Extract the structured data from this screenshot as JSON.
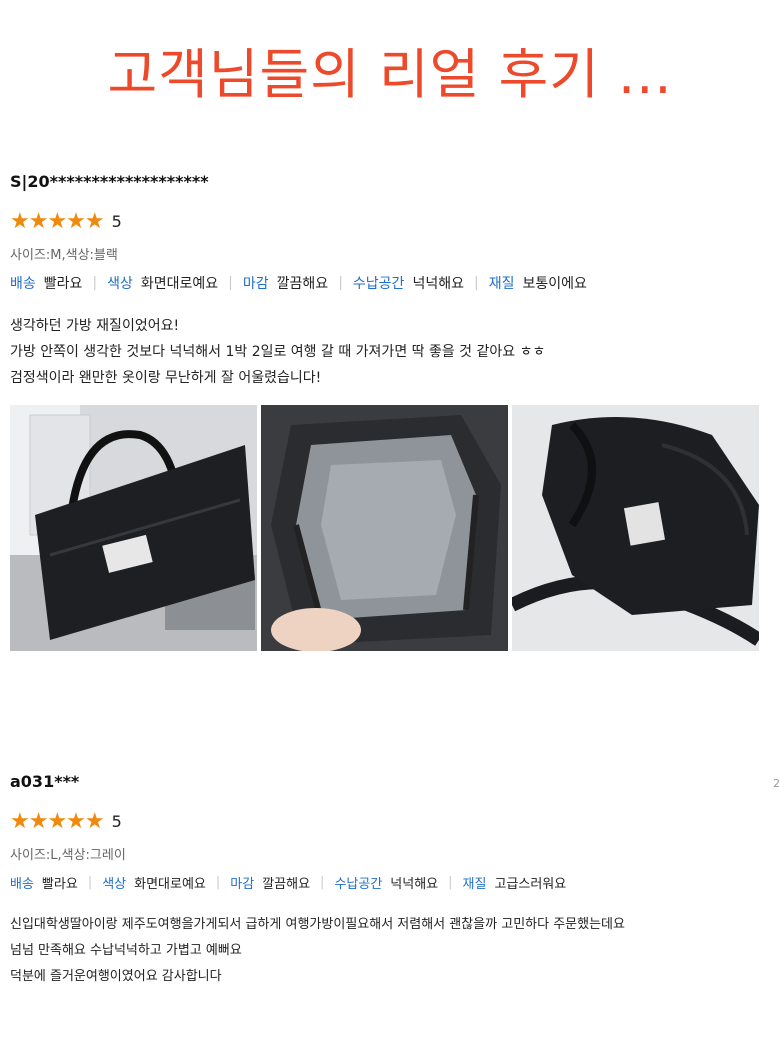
{
  "title": "고객님들의 리얼 후기 ...",
  "reviews": [
    {
      "user": "S|20*******************",
      "stars": "★★★★★",
      "score": "5",
      "options": "사이즈:M,색상:블랙",
      "attributes": [
        {
          "name": "배송",
          "value": "빨라요"
        },
        {
          "name": "색상",
          "value": "화면대로예요"
        },
        {
          "name": "마감",
          "value": "깔끔해요"
        },
        {
          "name": "수납공간",
          "value": "넉넉해요"
        },
        {
          "name": "재질",
          "value": "보통이에요"
        }
      ],
      "text": [
        "생각하던 가방 재질이었어요!",
        "가방 안쪽이 생각한 것보다 넉넉해서 1박 2일로 여행 갈 때 가져가면 딱 좋을 것 같아요 ㅎㅎ",
        "검정색이라 왠만한 옷이랑 무난하게 잘 어울렸습니다!"
      ]
    },
    {
      "user": "a031***",
      "stars": "★★★★★",
      "score": "5",
      "options": "사이즈:L,색상:그레이",
      "attributes": [
        {
          "name": "배송",
          "value": "빨라요"
        },
        {
          "name": "색상",
          "value": "화면대로예요"
        },
        {
          "name": "마감",
          "value": "깔끔해요"
        },
        {
          "name": "수납공간",
          "value": "넉넉해요"
        },
        {
          "name": "재질",
          "value": "고급스러워요"
        }
      ],
      "text": [
        "신입대학생딸아이랑 제주도여행을가게되서 급하게 여행가방이필요해서 저렴해서 괜찮을까 고민하다 주문했는데요",
        "넘넘 만족해요 수납넉넉하고 가볍고 예뻐요",
        "덕분에 즐거운여행이였어요 감사합니다"
      ]
    }
  ],
  "page_number": "2",
  "colors": {
    "title": "#ec4a2a",
    "star": "#f08a0e",
    "attribute_name": "#1f6fcc"
  }
}
